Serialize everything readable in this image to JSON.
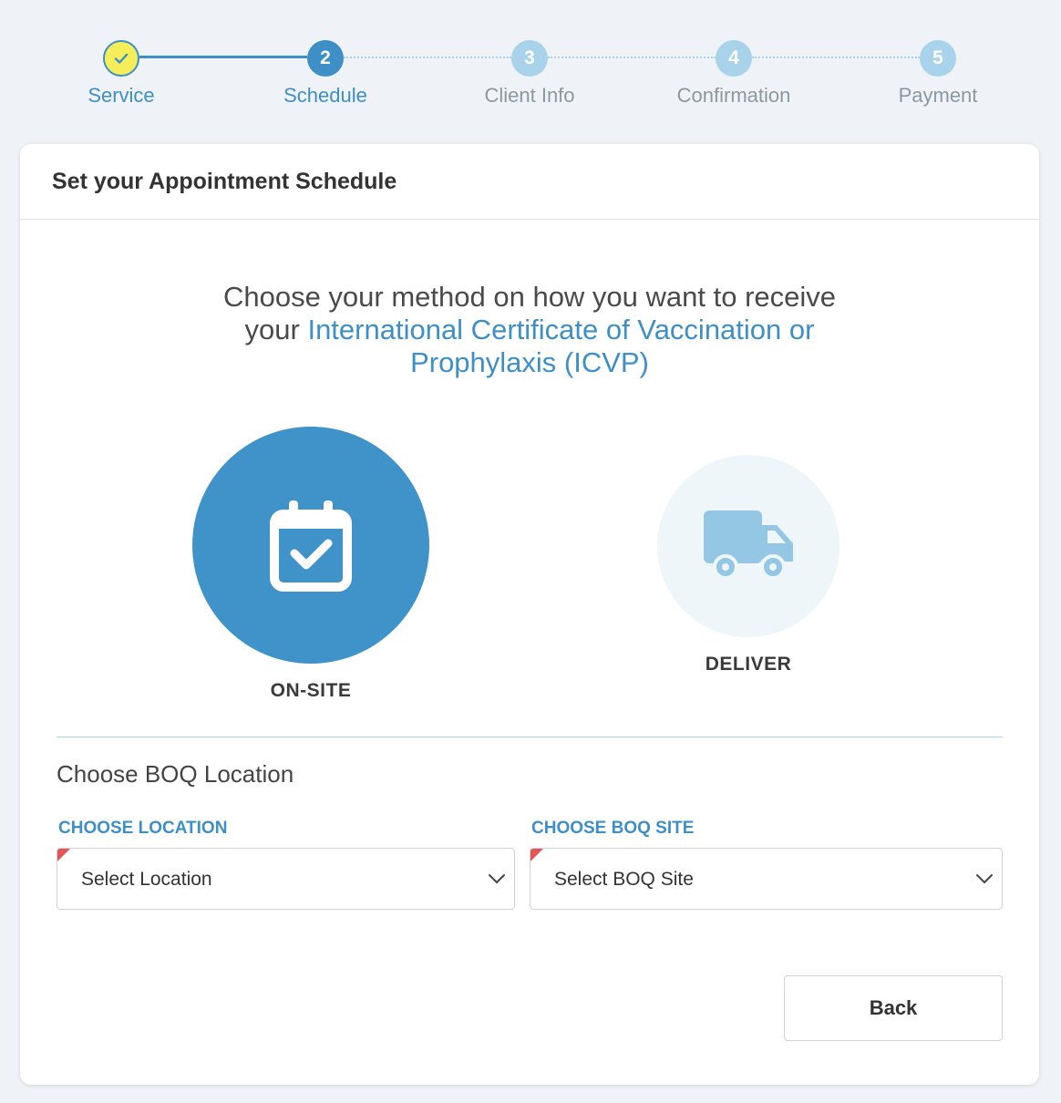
{
  "stepper": {
    "steps": [
      {
        "number": "",
        "label": "Service",
        "state": "done"
      },
      {
        "number": "2",
        "label": "Schedule",
        "state": "active"
      },
      {
        "number": "3",
        "label": "Client Info",
        "state": "pending"
      },
      {
        "number": "4",
        "label": "Confirmation",
        "state": "pending"
      },
      {
        "number": "5",
        "label": "Payment",
        "state": "pending"
      }
    ]
  },
  "card": {
    "title": "Set your Appointment Schedule",
    "intro_line1": "Choose your method on how you want to receive",
    "intro_line2_prefix": "your ",
    "intro_highlight_a": "International Certificate of Vaccination or",
    "intro_highlight_b": "Prophylaxis (ICVP)",
    "methods": [
      {
        "label": "ON-SITE",
        "icon": "calendar-check-icon",
        "selected": true
      },
      {
        "label": "DELIVER",
        "icon": "truck-icon",
        "selected": false
      }
    ],
    "location_section_title": "Choose BOQ Location",
    "location_label": "CHOOSE LOCATION",
    "location_value": "Select Location",
    "site_label": "CHOOSE BOQ SITE",
    "site_value": "Select BOQ Site",
    "back_label": "Back"
  },
  "colors": {
    "accent": "#3f8fc7",
    "done_fill": "#f5ee5a",
    "pending": "#a9d3ea",
    "required_marker": "#e05555",
    "page_bg": "#eff2f6"
  }
}
